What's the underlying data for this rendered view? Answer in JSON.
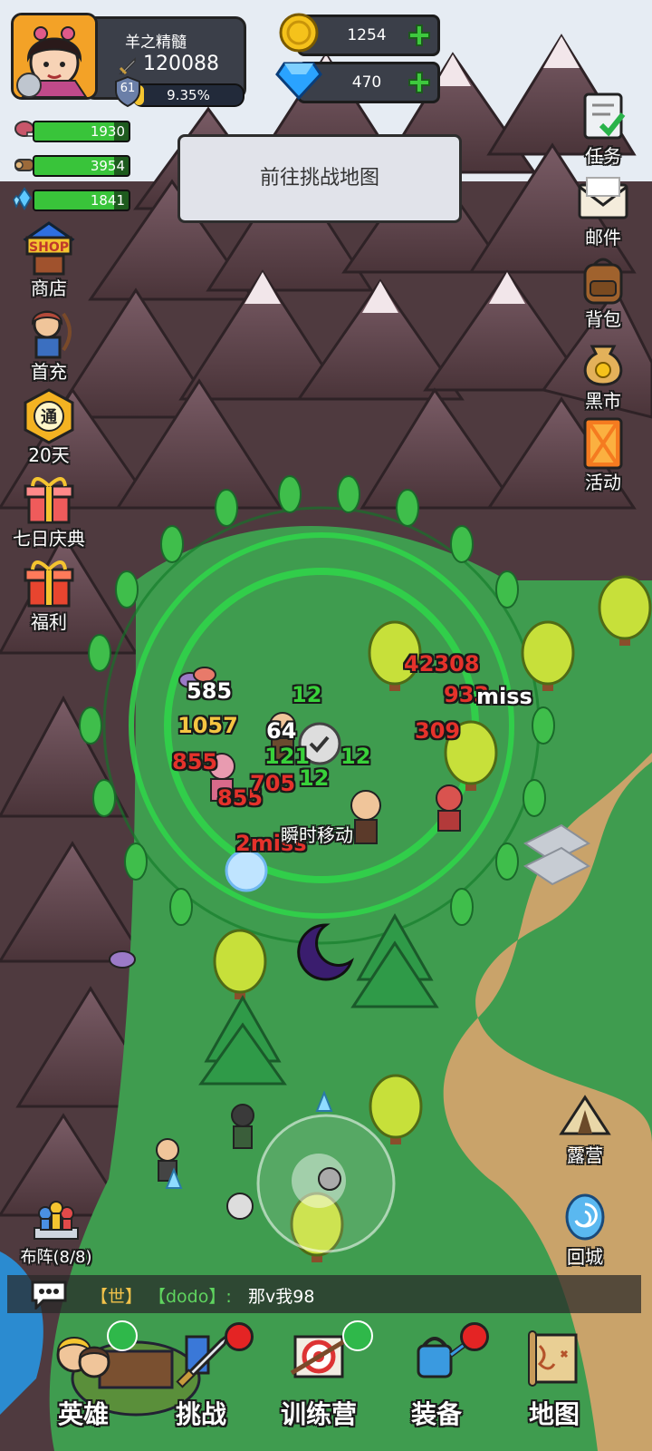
{
  "player": {
    "name": "羊之精髓",
    "power": "120088",
    "level": "61",
    "exp_percent_text": "9.35%",
    "exp_fraction": 0.0935
  },
  "currency": {
    "gold": "1254",
    "gems": "470"
  },
  "resources": [
    {
      "icon": "meat-icon",
      "value": "1930",
      "fill": 0.85
    },
    {
      "icon": "wood-log-icon",
      "value": "3954",
      "fill": 0.85
    },
    {
      "icon": "crystal-icon",
      "value": "1841",
      "fill": 0.85
    }
  ],
  "left_menu": [
    {
      "icon": "shop-icon",
      "label": "商店"
    },
    {
      "icon": "archer-hero-icon",
      "label": "首充"
    },
    {
      "icon": "pass-badge-icon",
      "label": "20天"
    },
    {
      "icon": "gift-box-icon",
      "label": "七日庆典"
    },
    {
      "icon": "gift-box-icon",
      "label": "福利"
    }
  ],
  "right_menu": [
    {
      "icon": "quest-scroll-icon",
      "label": "任务"
    },
    {
      "icon": "mail-envelope-icon",
      "label": "邮件"
    },
    {
      "icon": "backpack-icon",
      "label": "背包"
    },
    {
      "icon": "money-bag-icon",
      "label": "黑市"
    },
    {
      "icon": "event-card-icon",
      "label": "活动"
    }
  ],
  "dialog": {
    "text": "前往挑战地图"
  },
  "battle": {
    "skill_label": "瞬时移动",
    "damage_numbers": [
      {
        "text": "585",
        "color": "#ffffff"
      },
      {
        "text": "1057",
        "color": "#f5c542"
      },
      {
        "text": "64",
        "color": "#ffffff"
      },
      {
        "text": "855",
        "color": "#e5322b"
      },
      {
        "text": "855",
        "color": "#e5322b"
      },
      {
        "text": "705",
        "color": "#e5322b"
      },
      {
        "text": "2miss",
        "color": "#e5322b"
      },
      {
        "text": "42308",
        "color": "#e5322b"
      },
      {
        "text": "933",
        "color": "#e5322b"
      },
      {
        "text": "miss",
        "color": "#ffffff"
      },
      {
        "text": "309",
        "color": "#e5322b"
      },
      {
        "text": "12",
        "color": "#38d13a"
      },
      {
        "text": "121",
        "color": "#38d13a"
      },
      {
        "text": "12",
        "color": "#38d13a"
      },
      {
        "text": "12",
        "color": "#38d13a"
      }
    ]
  },
  "map_buttons": {
    "camp": "露营",
    "return_city": "回城",
    "formation": "布阵(8/8)"
  },
  "chat": {
    "channel": "【世】",
    "sender": "【dodo】:",
    "message": "那v我98"
  },
  "bottom_nav": [
    {
      "icon": "heroes-icon",
      "label": "英雄",
      "badge": "upgrade"
    },
    {
      "icon": "sword-icon",
      "label": "挑战",
      "badge": "red-dot"
    },
    {
      "icon": "target-icon",
      "label": "训练营",
      "badge": "upgrade"
    },
    {
      "icon": "watering-can-icon",
      "label": "装备",
      "badge": "red-dot"
    },
    {
      "icon": "scroll-map-icon",
      "label": "地图",
      "badge": ""
    }
  ],
  "colors": {
    "grass": "#3f9c4f",
    "mountain": "#6b4d56",
    "snow": "#e9eef4",
    "path": "#c9a36a",
    "accent_green": "#39c43a",
    "panel": "#3b3f49"
  }
}
